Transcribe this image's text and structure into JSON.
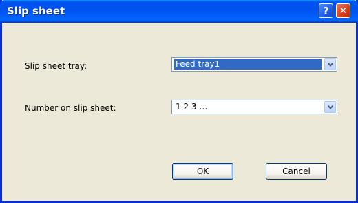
{
  "window": {
    "title": "Slip sheet"
  },
  "titlebar": {
    "help_glyph": "?",
    "close_glyph": "✕"
  },
  "fields": [
    {
      "label": "Slip sheet tray:",
      "value": "Feed tray1"
    },
    {
      "label": "Number on slip sheet:",
      "value": "1 2 3 …"
    }
  ],
  "buttons": {
    "ok_label": "OK",
    "cancel_label": "Cancel"
  },
  "colors": {
    "selection": "#316ac5",
    "titlebar": "#0054e3",
    "dialog_bg": "#ece9d8"
  }
}
